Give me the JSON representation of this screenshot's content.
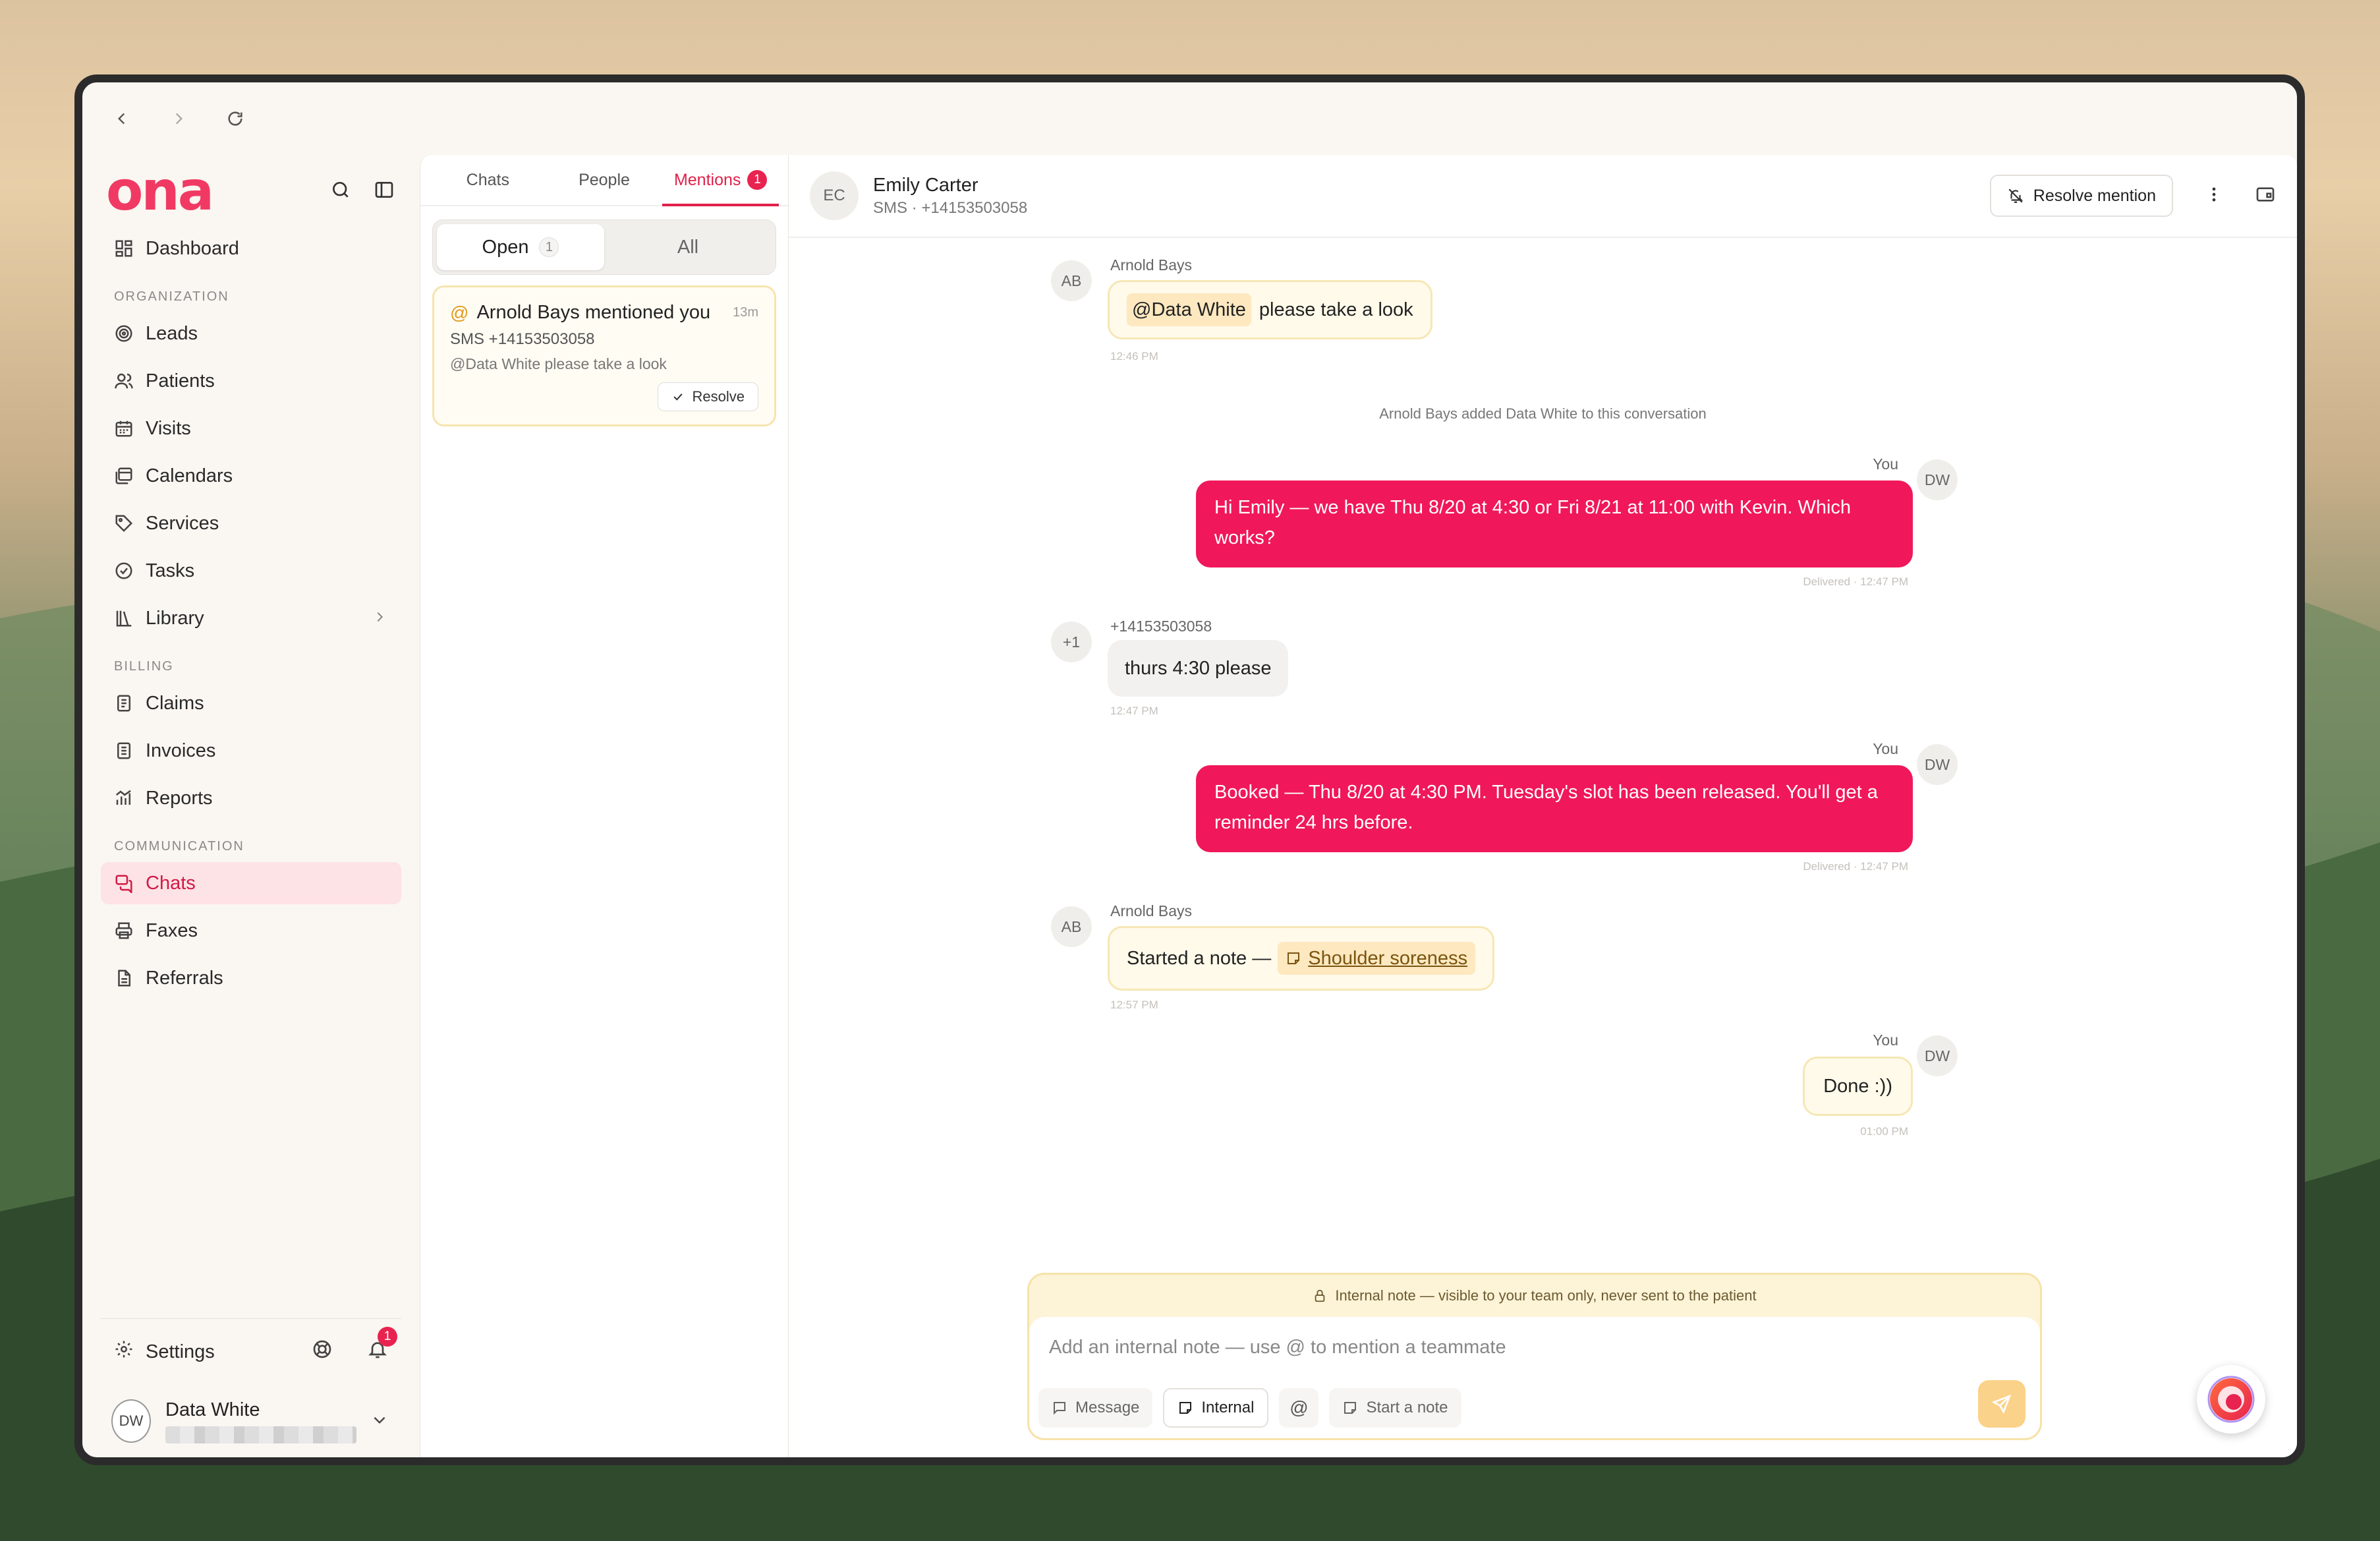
{
  "brand": {
    "name": "ona",
    "accent": "#f03a63"
  },
  "sidebar": {
    "dashboard": "Dashboard",
    "sections": [
      {
        "label": "ORGANIZATION"
      },
      {
        "label": "BILLING"
      },
      {
        "label": "COMMUNICATION"
      }
    ],
    "items": {
      "leads": "Leads",
      "patients": "Patients",
      "visits": "Visits",
      "calendars": "Calendars",
      "services": "Services",
      "tasks": "Tasks",
      "library": "Library",
      "claims": "Claims",
      "invoices": "Invoices",
      "reports": "Reports",
      "chats": "Chats",
      "faxes": "Faxes",
      "referrals": "Referrals"
    },
    "settings": "Settings",
    "notifications_count": "1",
    "user": {
      "initials": "DW",
      "name": "Data White"
    }
  },
  "middle": {
    "tabs": {
      "chats": "Chats",
      "people": "People",
      "mentions": "Mentions",
      "mentions_count": "1"
    },
    "segment": {
      "open": "Open",
      "open_count": "1",
      "all": "All"
    },
    "mention_card": {
      "title": "Arnold Bays mentioned you",
      "time": "13m",
      "channel": "SMS +14153503058",
      "preview": "@Data White please take a look",
      "resolve": "Resolve"
    }
  },
  "chat": {
    "contact": {
      "initials": "EC",
      "name": "Emily Carter",
      "sub": "SMS · +14153503058"
    },
    "resolve_mention": "Resolve mention",
    "messages": {
      "m1": {
        "avatar": "AB",
        "sender": "Arnold Bays",
        "mention": "@Data White",
        "text": "please take a look",
        "time": "12:46 PM"
      },
      "system": "Arnold Bays added Data White to this conversation",
      "m2": {
        "avatar": "DW",
        "sender": "You",
        "text": "Hi Emily — we have Thu 8/20 at 4:30 or Fri 8/21 at 11:00 with Kevin. Which works?",
        "time": "Delivered · 12:47 PM"
      },
      "m3": {
        "avatar": "+1",
        "sender": "+14153503058",
        "text": "thurs 4:30 please",
        "time": "12:47 PM"
      },
      "m4": {
        "avatar": "DW",
        "sender": "You",
        "text": "Booked — Thu 8/20 at 4:30 PM. Tuesday's slot has been released. You'll get a reminder 24 hrs before.",
        "time": "Delivered · 12:47 PM"
      },
      "m5": {
        "avatar": "AB",
        "sender": "Arnold Bays",
        "text": "Started a note —",
        "note": "Shoulder soreness",
        "time": "12:57 PM"
      },
      "m6": {
        "avatar": "DW",
        "sender": "You",
        "text": "Done :))",
        "time": "01:00 PM"
      }
    },
    "composer": {
      "banner": "Internal note — visible to your team only, never sent to the patient",
      "placeholder": "Add an internal note — use @ to mention a teammate",
      "message": "Message",
      "internal": "Internal",
      "start_note": "Start a note"
    }
  }
}
